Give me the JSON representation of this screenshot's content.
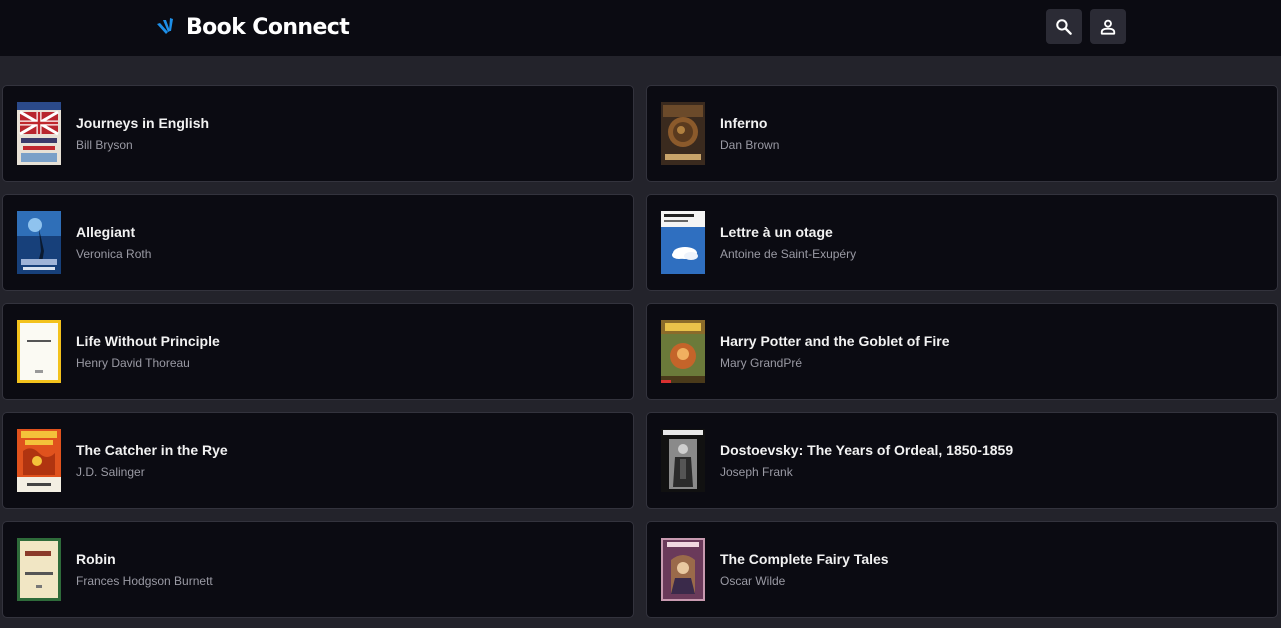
{
  "header": {
    "brand_name": "Book Connect",
    "search_icon": "search-icon",
    "profile_icon": "account-icon"
  },
  "colors": {
    "header_bg": "#0b0b12",
    "page_bg": "#23232b",
    "card_bg": "#0b0b12",
    "logo_blue": "#1d8fe8"
  },
  "books": [
    {
      "title": "Journeys in English",
      "author": "Bill Bryson"
    },
    {
      "title": "Inferno",
      "author": "Dan Brown"
    },
    {
      "title": "Allegiant",
      "author": "Veronica Roth"
    },
    {
      "title": "Lettre à un otage",
      "author": "Antoine de Saint-Exupéry"
    },
    {
      "title": "Life Without Principle",
      "author": "Henry David Thoreau"
    },
    {
      "title": "Harry Potter and the Goblet of Fire",
      "author": "Mary GrandPré"
    },
    {
      "title": "The Catcher in the Rye",
      "author": "J.D. Salinger"
    },
    {
      "title": "Dostoevsky: The Years of Ordeal, 1850-1859",
      "author": "Joseph Frank"
    },
    {
      "title": "Robin",
      "author": "Frances Hodgson Burnett"
    },
    {
      "title": "The Complete Fairy Tales",
      "author": "Oscar Wilde"
    }
  ]
}
